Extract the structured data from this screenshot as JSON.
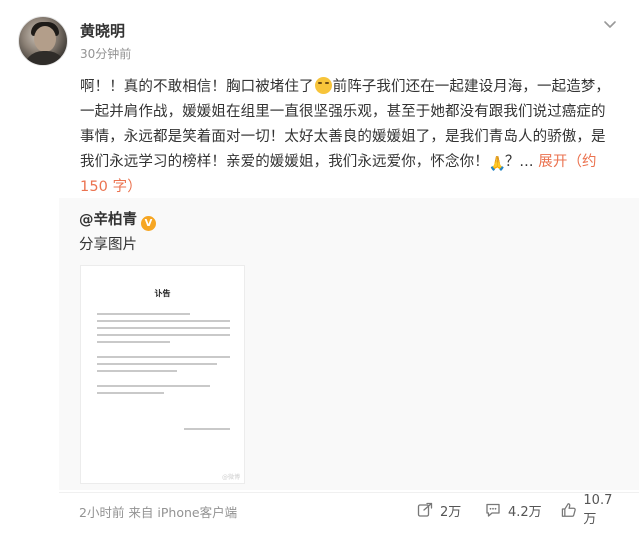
{
  "post": {
    "username": "黄晓明",
    "time_ago": "30分钟前",
    "text_part1": "啊！！真的不敢相信！胸口被堵住了",
    "text_part2": "前阵子我们还在一起建设月海，一起造梦，一起并肩作战，媛媛姐在组里一直很坚强乐观，甚至于她都没有跟我们说过癌症的事情，永远都是笑着面对一切！太好太善良的媛媛姐了，是我们青岛人的骄傲，是我们永远学习的榜样！亲爱的媛媛姐，我们永远爱你，怀念你！",
    "text_part3": "？... ",
    "expand_label": "展开（约 150 字）",
    "icons": {
      "menu": "chevron-down-icon",
      "cry": "crying-emoji-icon",
      "pray": "praying-hands-emoji-icon"
    }
  },
  "repost": {
    "username": "@辛柏青",
    "badge": "V",
    "text": "分享图片",
    "image": {
      "title": "讣告",
      "watermark": "@微博"
    }
  },
  "footer": {
    "meta": "2小时前  来自 iPhone客户端",
    "repost_count": "2万",
    "comment_count": "4.2万",
    "like_count": "10.7万"
  },
  "colors": {
    "accent": "#eb7350",
    "muted": "#939393",
    "repost_bg": "#f9f9f9",
    "badge": "#f6a623"
  }
}
